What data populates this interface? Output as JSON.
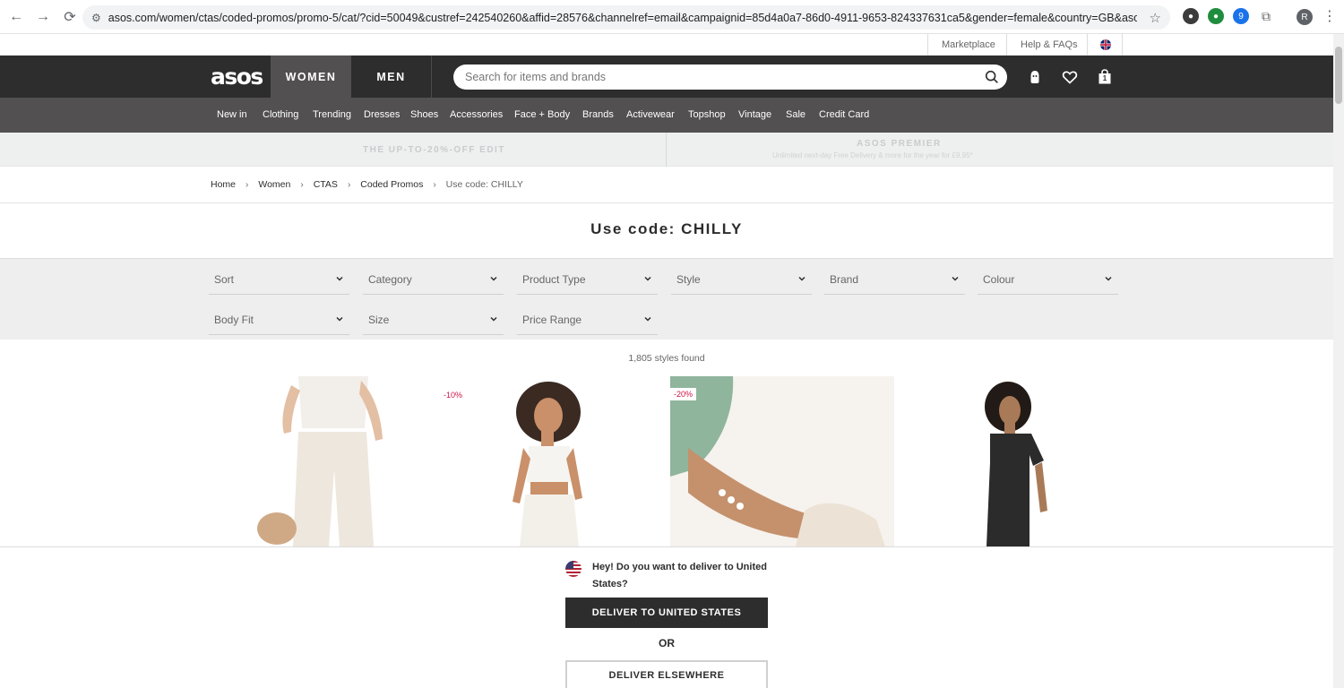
{
  "browser": {
    "url": "asos.com/women/ctas/coded-promos/promo-5/cat/?cid=50049&custref=242540260&affid=28576&channelref=email&campaignid=85d4a0a7-86d0-4911-9653-824337631ca5&gender=female&country=GB&asoscid=e3b0c44298fc1c14...",
    "profile_initial": "R",
    "extension_badge": "9"
  },
  "utility": {
    "marketplace": "Marketplace",
    "help": "Help & FAQs"
  },
  "header": {
    "logo": "asos",
    "tab_women": "WOMEN",
    "tab_men": "MEN",
    "search_placeholder": "Search for items and brands",
    "bag_count": "1"
  },
  "categories": [
    "New in",
    "Clothing",
    "Trending",
    "Dresses",
    "Shoes",
    "Accessories",
    "Face + Body",
    "Brands",
    "Activewear",
    "Topshop",
    "Vintage",
    "Sale",
    "Credit Card"
  ],
  "promo": {
    "left": "THE UP-TO-20%-OFF EDIT",
    "right_title": "ASOS PREMIER",
    "right_sub": "Unlimited next-day Free Delivery & more for the year for £9.95*"
  },
  "breadcrumb": [
    "Home",
    "Women",
    "CTAS",
    "Coded Promos",
    "Use code: CHILLY"
  ],
  "page_title": "Use code: CHILLY",
  "filters": [
    "Sort",
    "Category",
    "Product Type",
    "Style",
    "Brand",
    "Colour",
    "Body Fit",
    "Size",
    "Price Range"
  ],
  "styles_found": "1,805 styles found",
  "products": [
    {
      "badge": ""
    },
    {
      "badge": "-10%"
    },
    {
      "badge": "-20%"
    },
    {
      "badge": ""
    }
  ],
  "delivery_prompt": {
    "question": "Hey! Do you want to deliver to United States?",
    "primary": "DELIVER TO UNITED STATES",
    "or": "OR",
    "secondary": "DELIVER ELSEWHERE"
  },
  "colors": {
    "header_dark": "#2d2d2d",
    "nav_grey": "#525050",
    "sale_red": "#d01345"
  }
}
